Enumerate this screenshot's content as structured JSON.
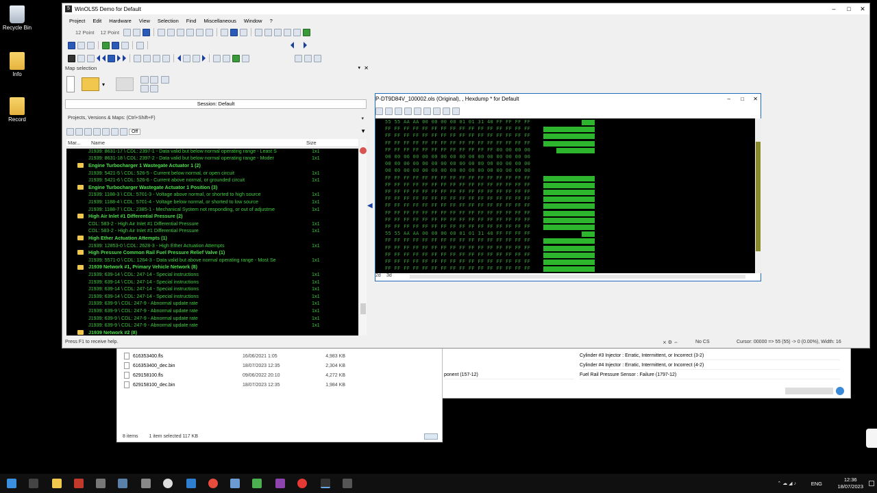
{
  "desktop": {
    "icons": [
      {
        "label": "Recycle Bin"
      },
      {
        "label": "Info"
      },
      {
        "label": "Record"
      }
    ]
  },
  "explorer": {
    "files": [
      {
        "name": "616353400.fls",
        "date": "16/06/2021 1:05",
        "size": "4,983 KB"
      },
      {
        "name": "616353400_dec.bin",
        "date": "18/07/2023 12:35",
        "size": "2,304 KB"
      },
      {
        "name": "629158100.fls",
        "date": "09/06/2022 20:10",
        "size": "4,272 KB"
      },
      {
        "name": "629158100_dec.bin",
        "date": "18/07/2023 12:35",
        "size": "1,984 KB"
      }
    ],
    "status_items": "8 items",
    "status_selected": "1 item selected  117 KB"
  },
  "dtc_panel": {
    "rows": [
      "Cylinder #3 Injector : Erratic, Intermittent, or Incorrect  (3-2)",
      "Cylinder #4 Injector : Erratic, Intermittent, or Incorrect  (4-2)",
      "Fuel Rail Pressure Sensor : Failure  (1797-12)"
    ],
    "left_fragment": "ponent (157-12)"
  },
  "winols": {
    "title": "WinOLS5 Demo for Default",
    "app_icon": "5",
    "menu": [
      "Project",
      "Edit",
      "Hardware",
      "View",
      "Selection",
      "Find",
      "Miscellaneous",
      "Window",
      "?"
    ],
    "font1": "12 Point",
    "font2": "12 Point",
    "map_selection": {
      "title": "Map selection",
      "session": "Session: Default",
      "projects_label": "Projects, Versions & Maps:  (Ctrl+Shift+F)",
      "filter_off": "Off",
      "col_mark": "Mar...",
      "col_name": "Name",
      "col_size": "Size"
    },
    "status_help": "Press F1 to receive help.",
    "status_cs": "No CS",
    "status_cursor": "Cursor: 00000 => 55 (55) -> 0 (0.00%), Width: 16"
  },
  "map_list": [
    {
      "type": "item",
      "text": "J1939: 8631-17 \\ CDL: 2397-1 - Data valid but below normal operating range - Least S",
      "size": "1x1"
    },
    {
      "type": "item",
      "text": "J1939: 8631-18 \\ CDL: 2397-2 - Data valid but below normal operating range - Moder",
      "size": "1x1"
    },
    {
      "type": "group",
      "text": "Engine Turbocharger 1 Wastegate Actuator 1 (2)",
      "size": ""
    },
    {
      "type": "item",
      "text": "J1939: 5421-5 \\ CDL: 526-5 - Current below normal, or open circuit",
      "size": "1x1"
    },
    {
      "type": "item",
      "text": "J1939: 5421-6 \\ CDL: 526-6 - Current above normal, or grounded circuit",
      "size": "1x1"
    },
    {
      "type": "group",
      "text": "Engine Turbocharger Wastegate Actuator 1 Position (3)",
      "size": ""
    },
    {
      "type": "item",
      "text": "J1939: 1188-3 \\ CDL: 5701-3 - Voltage above normal, or shorted to high source",
      "size": "1x1"
    },
    {
      "type": "item",
      "text": "J1939: 1188-4 \\ CDL: 5701-4 - Voltage below normal, or shorted to low source",
      "size": "1x1"
    },
    {
      "type": "item",
      "text": "J1939: 1188-7 \\ CDL: 2385-1 - Mechanical System not responding, or out of adjustme",
      "size": "1x1"
    },
    {
      "type": "group",
      "text": "High Air Inlet #1 Differential Pressure (2)",
      "size": ""
    },
    {
      "type": "item",
      "text": "CDL: 583-2 - High Air Inlet #1 Differential Pressure",
      "size": "1x1"
    },
    {
      "type": "item",
      "text": "CDL: 583-2 - High Air Inlet #1 Differential Pressure",
      "size": "1x1"
    },
    {
      "type": "group",
      "text": "High Ether Actuation Attempts (1)",
      "size": ""
    },
    {
      "type": "item",
      "text": "J1939: 12853-0 \\ CDL: 2628-3 - High Ether Actuation Attempts",
      "size": "1x1"
    },
    {
      "type": "group",
      "text": "High Pressure Common Rail Fuel Pressure Relief Valve (1)",
      "size": ""
    },
    {
      "type": "item",
      "text": "J1939: 5571-0 \\ CDL: 1264-3 - Data valid but above normal operating range - Most Se",
      "size": "1x1"
    },
    {
      "type": "group",
      "text": "J1939 Network #1, Primary Vehicle Network (8)",
      "size": ""
    },
    {
      "type": "item",
      "text": "J1939: 639-14 \\ CDL: 247-14 - Special instructions",
      "size": "1x1"
    },
    {
      "type": "item",
      "text": "J1939: 639-14 \\ CDL: 247-14 - Special instructions",
      "size": "1x1"
    },
    {
      "type": "item",
      "text": "J1939: 639-14 \\ CDL: 247-14 - Special instructions",
      "size": "1x1"
    },
    {
      "type": "item",
      "text": "J1939: 639-14 \\ CDL: 247-14 - Special instructions",
      "size": "1x1"
    },
    {
      "type": "item",
      "text": "J1939: 639-9 \\ CDL: 247-9 - Abnormal update rate",
      "size": "1x1"
    },
    {
      "type": "item",
      "text": "J1939: 639-9 \\ CDL: 247-9 - Abnormal update rate",
      "size": "1x1"
    },
    {
      "type": "item",
      "text": "J1939: 639-9 \\ CDL: 247-9 - Abnormal update rate",
      "size": "1x1"
    },
    {
      "type": "item",
      "text": "J1939: 639-9 \\ CDL: 247-9 - Abnormal update rate",
      "size": "1x1"
    },
    {
      "type": "group",
      "text": "J1939 Network #2 (8)",
      "size": ""
    }
  ],
  "hexwin": {
    "title": "P-DT9D84V_100002.ols (Original), , Hexdump * for Default",
    "foot_2d": "2d",
    "foot_3d": "3d",
    "lines": [
      "55 55 AA AA 00 00 00 00 01 01 31 40 FF FF FF FF",
      "FF FF FF FF FF FF FF FF FF FF FF FF FF FF FF FF",
      "FF FF FF FF FF FF FF FF FF FF FF FF FF FF FF FF",
      "FF FF FF FF FF FF FF FF FF FF FF FF FF FF FF FF",
      "FF FF FF FF FF FF FF FF FF FF FF FF 00 00 00 00",
      "00 00 00 00 00 00 00 00 00 00 00 00 00 00 00 00",
      "00 00 00 00 00 00 00 00 00 00 00 00 00 00 00 00",
      "00 00 00 00 00 00 00 00 00 00 00 00 00 00 00 00",
      "FF FF FF FF FF FF FF FF FF FF FF FF FF FF FF FF",
      "FF FF FF FF FF FF FF FF FF FF FF FF FF FF FF FF",
      "FF FF FF FF FF FF FF FF FF FF FF FF FF FF FF FF",
      "FF FF FF FF FF FF FF FF FF FF FF FF FF FF FF FF",
      "FF FF FF FF FF FF FF FF FF FF FF FF FF FF FF FF",
      "FF FF FF FF FF FF FF FF FF FF FF FF FF FF FF FF",
      "FF FF FF FF FF FF FF FF FF FF FF FF FF FF FF FF",
      "FF FF FF FF FF FF FF FF FF FF FF FF FF FF FF FF",
      "55 55 AA AA 00 00 00 00 01 01 31 40 FF FF FF FF",
      "FF FF FF FF FF FF FF FF FF FF FF FF FF FF FF FF",
      "FF FF FF FF FF FF FF FF FF FF FF FF FF FF FF FF",
      "FF FF FF FF FF FF FF FF FF FF FF FF FF FF FF FF",
      "FF FF FF FF FF FF FF FF FF FF FF FF FF FF FF FF",
      "FF FF FF FF FF FF FF FF FF FF FF FF FF FF FF FF"
    ]
  },
  "taskbar": {
    "lang": "ENG",
    "time": "12:36",
    "date": "18/07/2023"
  },
  "colors": {
    "list_text": "#3ecf3e",
    "hex_text": "#3aa23a",
    "hex_bar": "#2db52d",
    "folder": "#f1c74e"
  }
}
